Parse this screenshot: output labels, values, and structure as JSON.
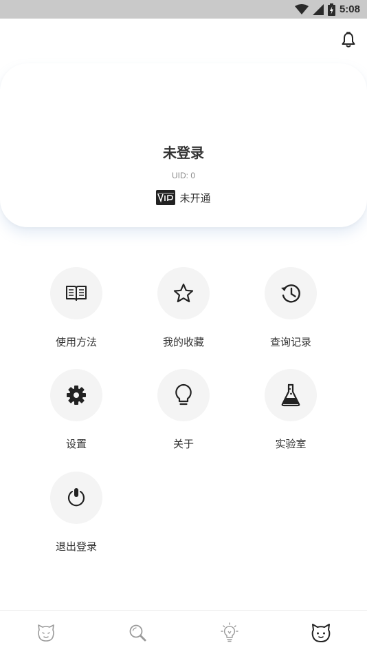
{
  "status_bar": {
    "time": "5:08",
    "icons": [
      "wifi-icon",
      "signal-icon",
      "battery-icon"
    ]
  },
  "header": {
    "icons": [
      "bell-icon"
    ]
  },
  "profile": {
    "name": "未登录",
    "uid": "UID: 0",
    "vip_badge": "VIP",
    "vip_status": "未开通"
  },
  "menu": {
    "items": [
      {
        "label": "使用方法",
        "icon": "book-icon"
      },
      {
        "label": "我的收藏",
        "icon": "star-icon"
      },
      {
        "label": "查询记录",
        "icon": "history-icon"
      },
      {
        "label": "设置",
        "icon": "gear-icon"
      },
      {
        "label": "关于",
        "icon": "lightbulb-icon"
      },
      {
        "label": "实验室",
        "icon": "flask-icon"
      },
      {
        "label": "退出登录",
        "icon": "power-icon"
      }
    ]
  },
  "bottom_nav": {
    "tabs": [
      {
        "icon": "cat-face-icon",
        "active": false
      },
      {
        "icon": "search-icon",
        "active": false
      },
      {
        "icon": "idea-icon",
        "active": false
      },
      {
        "icon": "profile-cat-icon",
        "active": true
      }
    ]
  },
  "colors": {
    "status_bar_bg": "#c9c9c9",
    "circle_bg": "#f4f4f4",
    "text": "#333333",
    "muted_text": "#8a8a8a",
    "inactive_nav": "#9a9a9a"
  }
}
